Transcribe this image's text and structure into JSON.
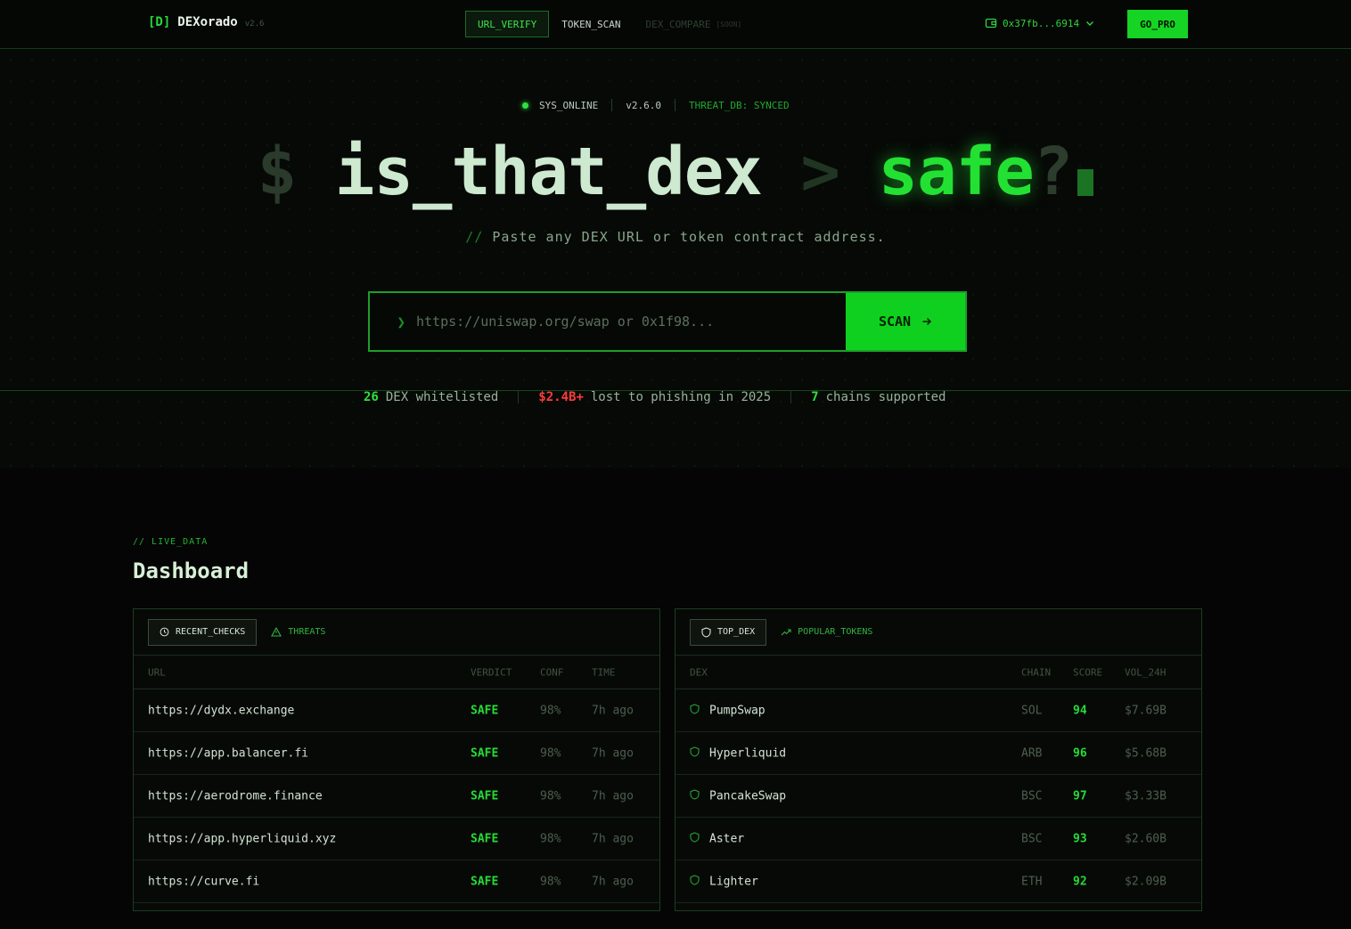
{
  "header": {
    "logo_mark": "[D]",
    "logo_name": "DEXorado",
    "logo_version": "v2.6",
    "nav": [
      {
        "label": "URL_VERIFY",
        "active": true
      },
      {
        "label": "TOKEN_SCAN"
      },
      {
        "label": "DEX_COMPARE",
        "soon": "[SOON]"
      }
    ],
    "wallet": "0x37fb...6914",
    "go_pro": "GO_PRO"
  },
  "status": {
    "online": "SYS_ONLINE",
    "version": "v2.6.0",
    "threat_db": "THREAT_DB: SYNCED"
  },
  "hero": {
    "prompt": "$",
    "command": "is_that_dex",
    "gt": ">",
    "answer": "safe",
    "question_mark": "?",
    "subtitle_prefix": "//",
    "subtitle": "Paste any DEX URL or token contract address.",
    "search_prompt": "❯",
    "search_placeholder": "https://uniswap.org/swap or 0x1f98...",
    "scan_label": "SCAN"
  },
  "stats": [
    {
      "value": "26",
      "label": "DEX whitelisted"
    },
    {
      "value": "$2.4B+",
      "label": "lost to phishing in 2025"
    },
    {
      "value": "7",
      "label": "chains supported"
    }
  ],
  "dashboard": {
    "label": "// LIVE_DATA",
    "title": "Dashboard",
    "left": {
      "tabs": [
        "RECENT_CHECKS",
        "THREATS"
      ],
      "columns": [
        "URL",
        "VERDICT",
        "CONF",
        "TIME"
      ],
      "rows": [
        {
          "url": "https://dydx.exchange",
          "verdict": "SAFE",
          "conf": "98%",
          "time": "7h ago"
        },
        {
          "url": "https://app.balancer.fi",
          "verdict": "SAFE",
          "conf": "98%",
          "time": "7h ago"
        },
        {
          "url": "https://aerodrome.finance",
          "verdict": "SAFE",
          "conf": "98%",
          "time": "7h ago"
        },
        {
          "url": "https://app.hyperliquid.xyz",
          "verdict": "SAFE",
          "conf": "98%",
          "time": "7h ago"
        },
        {
          "url": "https://curve.fi",
          "verdict": "SAFE",
          "conf": "98%",
          "time": "7h ago"
        }
      ]
    },
    "right": {
      "tabs": [
        "TOP_DEX",
        "POPULAR_TOKENS"
      ],
      "columns": [
        "DEX",
        "CHAIN",
        "SCORE",
        "VOL_24H"
      ],
      "rows": [
        {
          "dex": "PumpSwap",
          "chain": "SOL",
          "score": "94",
          "vol": "$7.69B"
        },
        {
          "dex": "Hyperliquid",
          "chain": "ARB",
          "score": "96",
          "vol": "$5.68B"
        },
        {
          "dex": "PancakeSwap",
          "chain": "BSC",
          "score": "97",
          "vol": "$3.33B"
        },
        {
          "dex": "Aster",
          "chain": "BSC",
          "score": "93",
          "vol": "$2.60B"
        },
        {
          "dex": "Lighter",
          "chain": "ETH",
          "score": "92",
          "vol": "$2.09B"
        }
      ]
    }
  }
}
